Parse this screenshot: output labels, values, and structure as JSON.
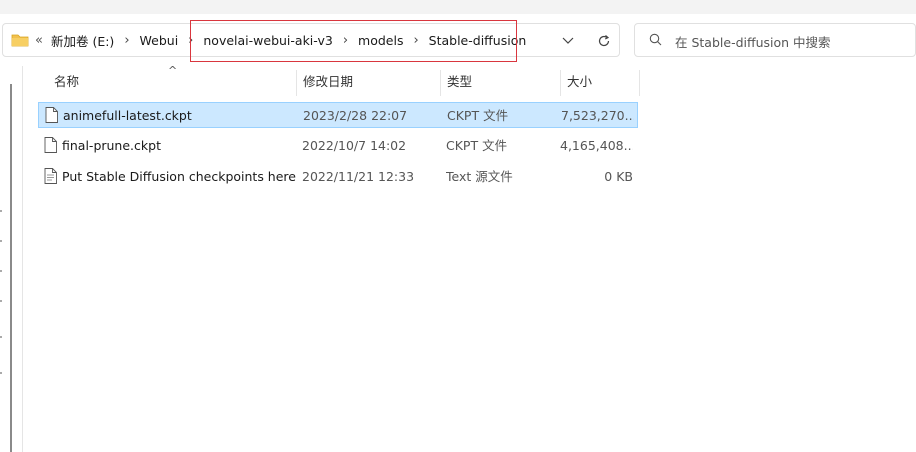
{
  "breadcrumb": {
    "overflow": "«",
    "items": [
      "新加卷 (E:)",
      "Webui",
      "novelai-webui-aki-v3",
      "models",
      "Stable-diffusion"
    ],
    "separator": "›"
  },
  "search": {
    "placeholder": "在 Stable-diffusion 中搜索"
  },
  "columns": {
    "name": "名称",
    "date": "修改日期",
    "type": "类型",
    "size": "大小"
  },
  "files": [
    {
      "name": "animefull-latest.ckpt",
      "date": "2023/2/28 22:07",
      "type": "CKPT 文件",
      "size": "7,523,270...",
      "selected": true,
      "icon": "file-icon"
    },
    {
      "name": "final-prune.ckpt",
      "date": "2022/10/7 14:02",
      "type": "CKPT 文件",
      "size": "4,165,408...",
      "selected": false,
      "icon": "file-icon"
    },
    {
      "name": "Put Stable Diffusion checkpoints here...",
      "date": "2022/11/21 12:33",
      "type": "Text 源文件",
      "size": "0 KB",
      "selected": false,
      "icon": "text-file-icon"
    }
  ],
  "colors": {
    "selection": "#cce8ff",
    "selection_border": "#99d1ff",
    "annotation": "#d9363e",
    "folder": "#f2c14e"
  }
}
